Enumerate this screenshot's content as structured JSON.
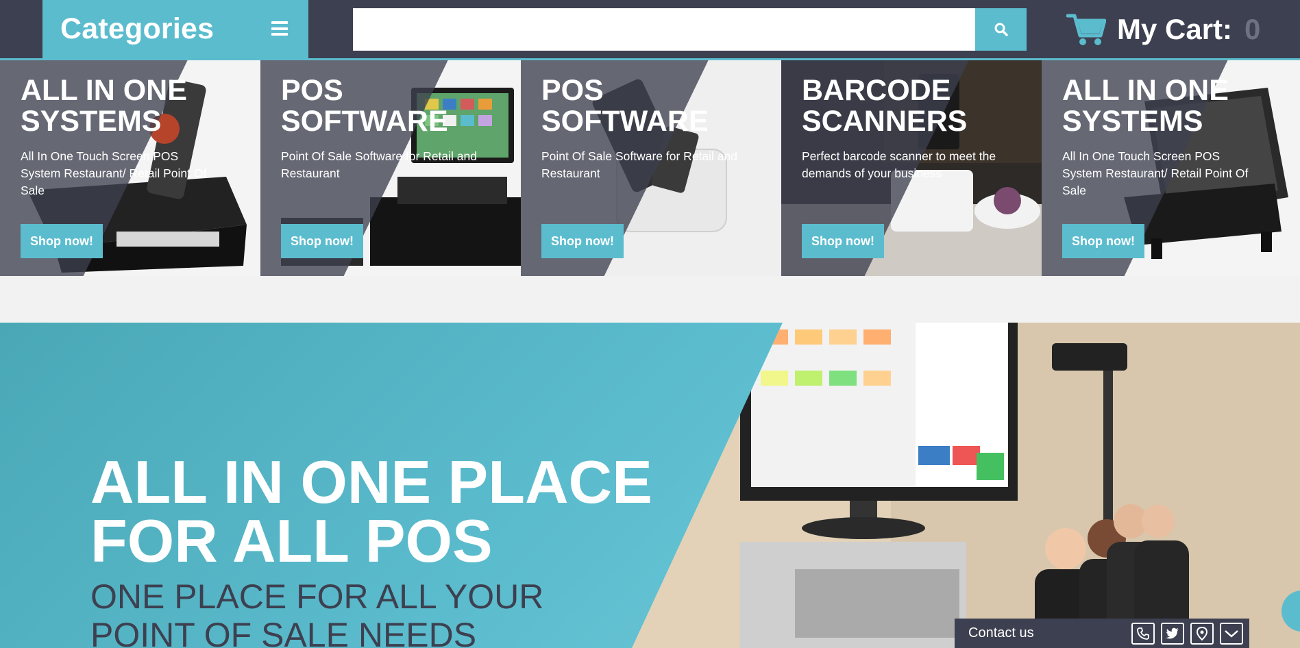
{
  "colors": {
    "accent": "#5bbcce",
    "dark": "#3d4050",
    "cart_count": "#6d7282"
  },
  "header": {
    "categories_label": "Categories",
    "menu_icon": "hamburger-icon",
    "search": {
      "placeholder": "",
      "value": "",
      "button_icon": "search-icon"
    },
    "cart": {
      "icon": "cart-icon",
      "label": "My Cart:",
      "count": "0"
    }
  },
  "banners": [
    {
      "title": "ALL IN ONE\nSYSTEMS",
      "description": "All In One Touch Screen POS System Restaurant/ Retail Point Of Sale",
      "button": "Shop now!"
    },
    {
      "title": "POS\nSOFTWARE",
      "description": "Point Of Sale Software for Retail and Restaurant",
      "button": "Shop now!"
    },
    {
      "title": "POS\nSOFTWARE",
      "description": "Point Of Sale Software for Retail and Restaurant",
      "button": "Shop now!"
    },
    {
      "title": "BARCODE\nSCANNERS",
      "description": "Perfect barcode scanner to meet the demands of your business",
      "button": "Shop now!"
    },
    {
      "title": "ALL IN ONE\nSYSTEMS",
      "description": "All In One Touch Screen POS System Restaurant/ Retail Point Of Sale",
      "button": "Shop now!"
    }
  ],
  "hero": {
    "heading": "ALL IN ONE PLACE\nFOR ALL POS",
    "subheading": "ONE PLACE FOR ALL YOUR\nPOINT OF SALE NEEDS"
  },
  "contact": {
    "label": "Contact us",
    "icons": [
      "phone-icon",
      "twitter-icon",
      "map-marker-icon",
      "chevron-down-icon"
    ]
  }
}
